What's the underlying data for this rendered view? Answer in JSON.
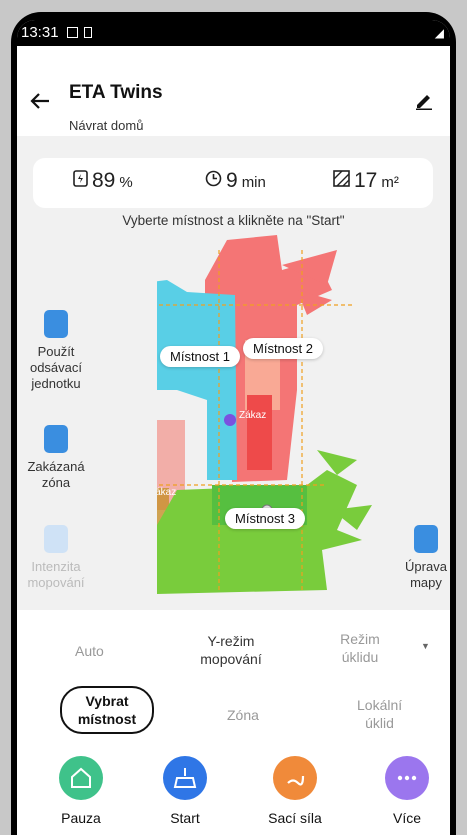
{
  "status_bar": {
    "time": "13:31"
  },
  "header": {
    "title": "ETA Twins",
    "subtitle": "Návrat domů"
  },
  "stats": {
    "battery": {
      "value": "89",
      "unit": "%"
    },
    "time": {
      "value": "9",
      "unit": "min"
    },
    "area": {
      "value": "17",
      "unit": "m²"
    }
  },
  "hint": "Vyberte místnost a klikněte na \"Start\"",
  "map": {
    "rooms": [
      "Místnost 1",
      "Místnost 2",
      "Místnost 3"
    ],
    "zones": [
      "Zákaz",
      "Zákaz"
    ],
    "colors": {
      "room1": "#59cfe6",
      "room2": "#f47575",
      "room3": "#79cc3c"
    }
  },
  "side_tools": [
    {
      "label": "Použít odsávací jednotku"
    },
    {
      "label": "Zakázaná zóna"
    },
    {
      "label": "Intenzita mopování"
    },
    {
      "label": "Úprava mapy"
    }
  ],
  "modes": {
    "row1": [
      "Auto",
      "Y-režim mopování",
      "Režim úklidu"
    ],
    "row2": [
      "Vybrat místnost",
      "Zóna",
      "Lokální úklid"
    ]
  },
  "actions": [
    {
      "label": "Pauza",
      "icon": "home-icon",
      "color": "#3fc28a"
    },
    {
      "label": "Start",
      "icon": "broom-icon",
      "color": "#2f76e6"
    },
    {
      "label": "Sací síla",
      "icon": "suction-icon",
      "color": "#f08a3a"
    },
    {
      "label": "Více",
      "icon": "more-icon",
      "color": "#9b76ee"
    }
  ]
}
